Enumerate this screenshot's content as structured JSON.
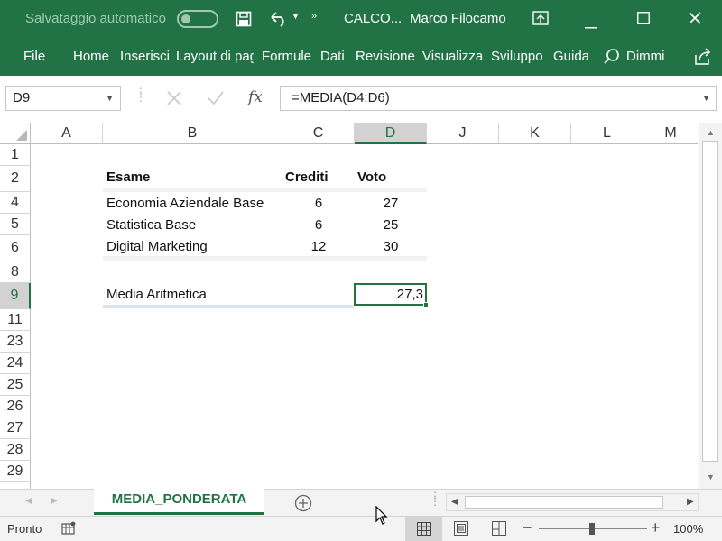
{
  "titlebar": {
    "autosave_label": "Salvataggio automatico",
    "doc_title": "CALCO...",
    "user_name": "Marco Filocamo"
  },
  "ribbon": {
    "tabs": [
      "File",
      "Home",
      "Inserisci",
      "Layout di pag",
      "Formule",
      "Dati",
      "Revisione",
      "Visualizza",
      "Sviluppo",
      "Guida"
    ],
    "tell_me": "Dimmi"
  },
  "formula_bar": {
    "name_box": "D9",
    "fx_label": "fx",
    "formula": "=MEDIA(D4:D6)"
  },
  "grid": {
    "columns": [
      "A",
      "B",
      "C",
      "D",
      "J",
      "K",
      "L",
      "M"
    ],
    "rows": [
      "1",
      "2",
      "4",
      "5",
      "6",
      "8",
      "9",
      "11",
      "23",
      "24",
      "25",
      "26",
      "27",
      "28",
      "29"
    ],
    "header": {
      "exam": "Esame",
      "credits": "Crediti",
      "grade": "Voto"
    },
    "data_rows": [
      {
        "exam": "Economia Aziendale Base",
        "credits": "6",
        "grade": "27"
      },
      {
        "exam": "Statistica Base",
        "credits": "6",
        "grade": "25"
      },
      {
        "exam": "Digital Marketing",
        "credits": "12",
        "grade": "30"
      }
    ],
    "result": {
      "label": "Media Aritmetica",
      "value": "27,3"
    }
  },
  "sheet": {
    "active_tab": "MEDIA_PONDERATA"
  },
  "status": {
    "mode": "Pronto",
    "zoom": "100%",
    "zoom_level": 1.0
  },
  "colors": {
    "brand": "#217346",
    "selected_header": "#d2d2d2"
  }
}
